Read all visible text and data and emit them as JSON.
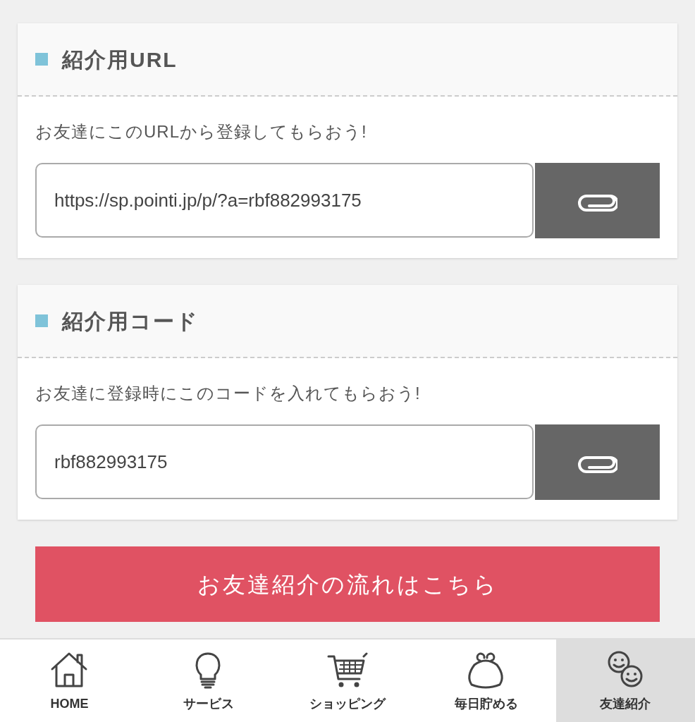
{
  "sections": [
    {
      "title": "紹介用URL",
      "description": "お友達にこのURLから登録してもらおう!",
      "field": {
        "value": "https://sp.pointi.jp/p/?a=rbf882993175"
      }
    },
    {
      "title": "紹介用コード",
      "description": "お友達に登録時にこのコードを入れてもらおう!",
      "field": {
        "value": "rbf882993175"
      }
    }
  ],
  "flow_button": "お友達紹介の流れはこちら",
  "tab_bar": [
    {
      "label": "HOME",
      "kind": "home",
      "selected": false
    },
    {
      "label": "サービス",
      "kind": "bulb",
      "selected": false
    },
    {
      "label": "ショッピング",
      "kind": "cart",
      "selected": false
    },
    {
      "label": "毎日貯める",
      "kind": "purse",
      "selected": false
    },
    {
      "label": "友達紹介",
      "kind": "friends",
      "selected": true
    }
  ]
}
